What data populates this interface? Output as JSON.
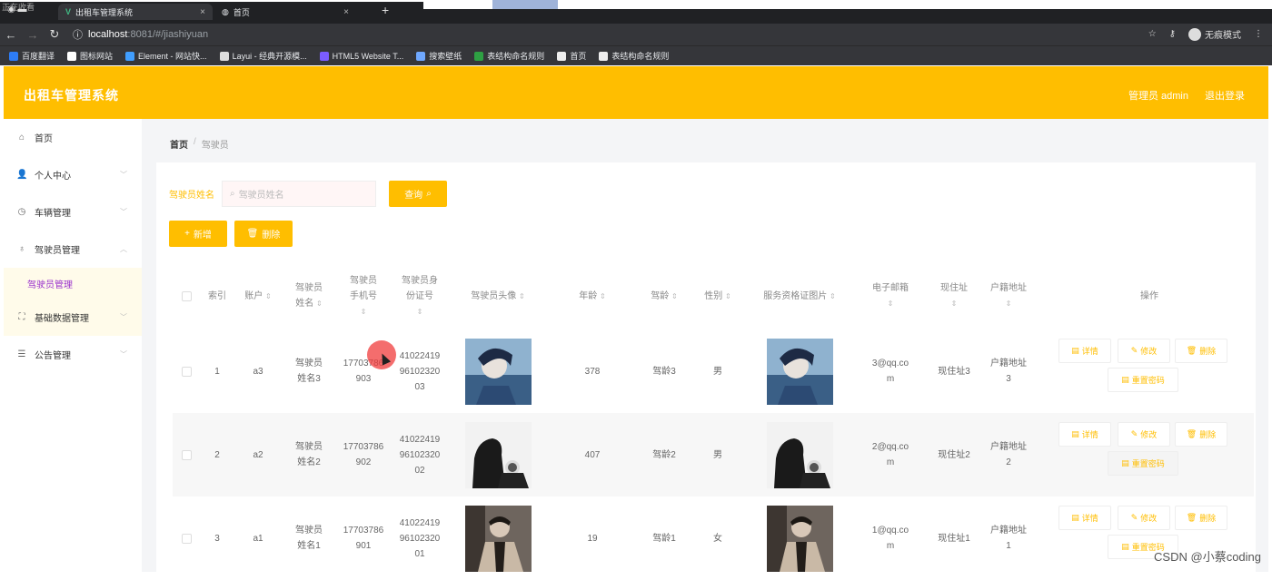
{
  "browser": {
    "overlay_text": "正在收看",
    "tabs": [
      {
        "label": "出租车管理系统",
        "close": "×"
      },
      {
        "label": "首页",
        "close": "×"
      }
    ],
    "new_tab": "+",
    "url_host": "localhost",
    "url_path": ":8081/#/jiashiyuan",
    "incognito_label": "无痕模式",
    "bookmarks": [
      {
        "label": "百度翻译",
        "color": "#2d7cf6"
      },
      {
        "label": "图标网站",
        "color": "#ffffff"
      },
      {
        "label": "Element - 网站快...",
        "color": "#409eff"
      },
      {
        "label": "Layui - 经典开源模...",
        "color": "#dddddd"
      },
      {
        "label": "HTML5 Website T...",
        "color": "#7a5cff"
      },
      {
        "label": "搜索壁纸",
        "color": "#6fa8ff"
      },
      {
        "label": "表结构命名规则",
        "color": "#2ea043"
      },
      {
        "label": "首页",
        "color": "#eeeeee"
      },
      {
        "label": "表结构命名规则",
        "color": "#eeeeee"
      }
    ]
  },
  "header": {
    "title": "出租车管理系统",
    "user": "管理员 admin",
    "logout": "退出登录"
  },
  "sidebar": {
    "items": [
      {
        "label": "首页",
        "icon": "home-icon"
      },
      {
        "label": "个人中心",
        "icon": "user-icon"
      },
      {
        "label": "车辆管理",
        "icon": "clock-icon"
      },
      {
        "label": "驾驶员管理",
        "icon": "mic-icon"
      },
      {
        "label": "基础数据管理",
        "icon": "expand-icon"
      },
      {
        "label": "公告管理",
        "icon": "list-icon"
      }
    ],
    "submenu_label": "驾驶员管理"
  },
  "breadcrumb": {
    "home": "首页",
    "sep": "/",
    "current": "驾驶员"
  },
  "search": {
    "label": "驾驶员姓名",
    "placeholder": "驾驶员姓名",
    "query_button": "查询"
  },
  "toolbar": {
    "add_label": "新增",
    "delete_label": "删除"
  },
  "table": {
    "columns": {
      "index": "索引",
      "account": "账户",
      "name": "驾驶员姓名",
      "phone": "驾驶员手机号",
      "idcard": "驾驶员身份证号",
      "avatar": "驾驶员头像",
      "age": "年龄",
      "driving_years": "驾龄",
      "gender": "性别",
      "cert": "服务资格证图片",
      "email": "电子邮箱",
      "current_addr": "现住址",
      "household_addr": "户籍地址",
      "ops": "操作"
    },
    "rows": [
      {
        "index": "1",
        "account": "a3",
        "name": "驾驶员姓名3",
        "phone": "17703786903",
        "idcard": "410224199610232003",
        "age": "378",
        "driving_years": "驾龄3",
        "gender": "男",
        "email": "3@qq.com",
        "current_addr": "现住址3",
        "household_addr": "户籍地址3"
      },
      {
        "index": "2",
        "account": "a2",
        "name": "驾驶员姓名2",
        "phone": "17703786902",
        "idcard": "410224199610232002",
        "age": "407",
        "driving_years": "驾龄2",
        "gender": "男",
        "email": "2@qq.com",
        "current_addr": "现住址2",
        "household_addr": "户籍地址2"
      },
      {
        "index": "3",
        "account": "a1",
        "name": "驾驶员姓名1",
        "phone": "17703786901",
        "idcard": "410224199610232001",
        "age": "19",
        "driving_years": "驾龄1",
        "gender": "女",
        "email": "1@qq.com",
        "current_addr": "现住址1",
        "household_addr": "户籍地址1"
      }
    ],
    "ops": {
      "detail": "详情",
      "edit": "修改",
      "delete": "删除",
      "reset_password": "重置密码"
    }
  },
  "watermark": "CSDN @小蔡coding",
  "colors": {
    "accent": "#ffbe00",
    "submenu_text": "#9b33cc"
  }
}
